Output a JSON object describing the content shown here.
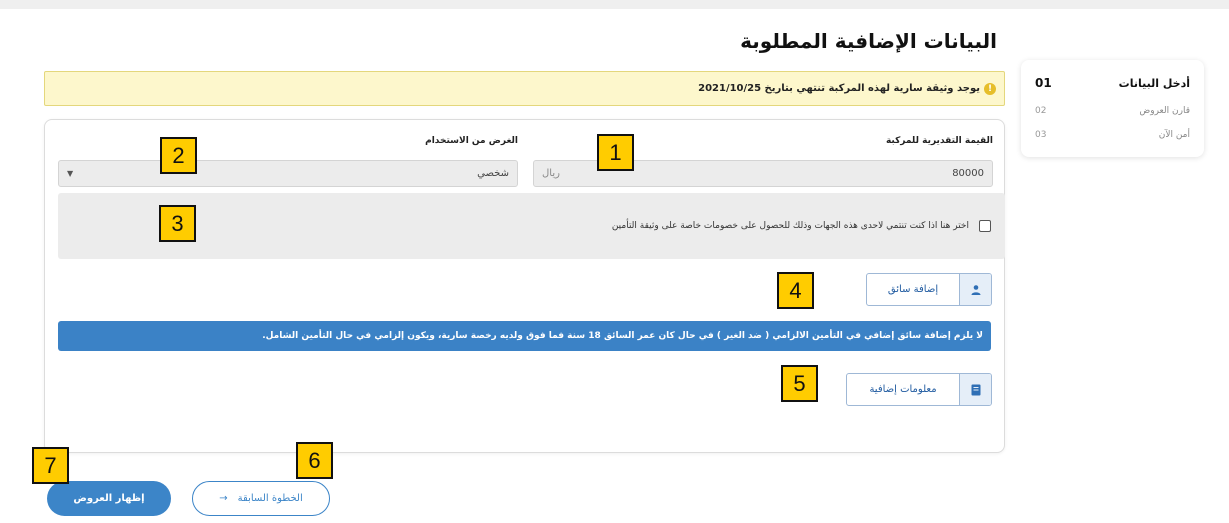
{
  "page": {
    "title": "البيانات الإضافية المطلوبة"
  },
  "alert": {
    "icon": "!",
    "text": "يوجد وثيقة سارية لهذه المركبة تنتهي بتاريخ 2021/10/25"
  },
  "steps": [
    {
      "num": "01",
      "label": "أدخل البيانات",
      "active": true
    },
    {
      "num": "02",
      "label": "قارن العروض",
      "active": false
    },
    {
      "num": "03",
      "label": "أمن الآن",
      "active": false
    }
  ],
  "form": {
    "vehicle_value_label": "القيمة التقديرية للمركبة",
    "vehicle_value": "80000",
    "vehicle_value_suffix": "ريال",
    "purpose_label": "الغرض من الاستخدام",
    "purpose_value": "شخصي",
    "discount_checkbox_label": "اختر هنا اذا كنت تنتمي لاحدى هذه الجهات وذلك للحصول على خصومات خاصة على وثيقة التأمين",
    "add_driver_label": "إضافة سائق",
    "info_note": "لا يلزم إضافة سائق إضافي في التأمين الالزامي ( ضد الغير ) في حال كان عمر السائق 18 سنة فما فوق ولديه رخصة سارية، ويكون إلزامي في حال التأمين الشامل.",
    "extra_info_label": "معلومات إضافية"
  },
  "actions": {
    "show_offers": "إظهار العروض",
    "previous_step": "الخطوة السابقة",
    "previous_arrow": "→"
  },
  "markers": [
    "1",
    "2",
    "3",
    "4",
    "5",
    "6",
    "7"
  ],
  "colors": {
    "primary": "#3c85c8",
    "alert_bg": "#fdf7cc",
    "marker": "#ffcc00"
  }
}
